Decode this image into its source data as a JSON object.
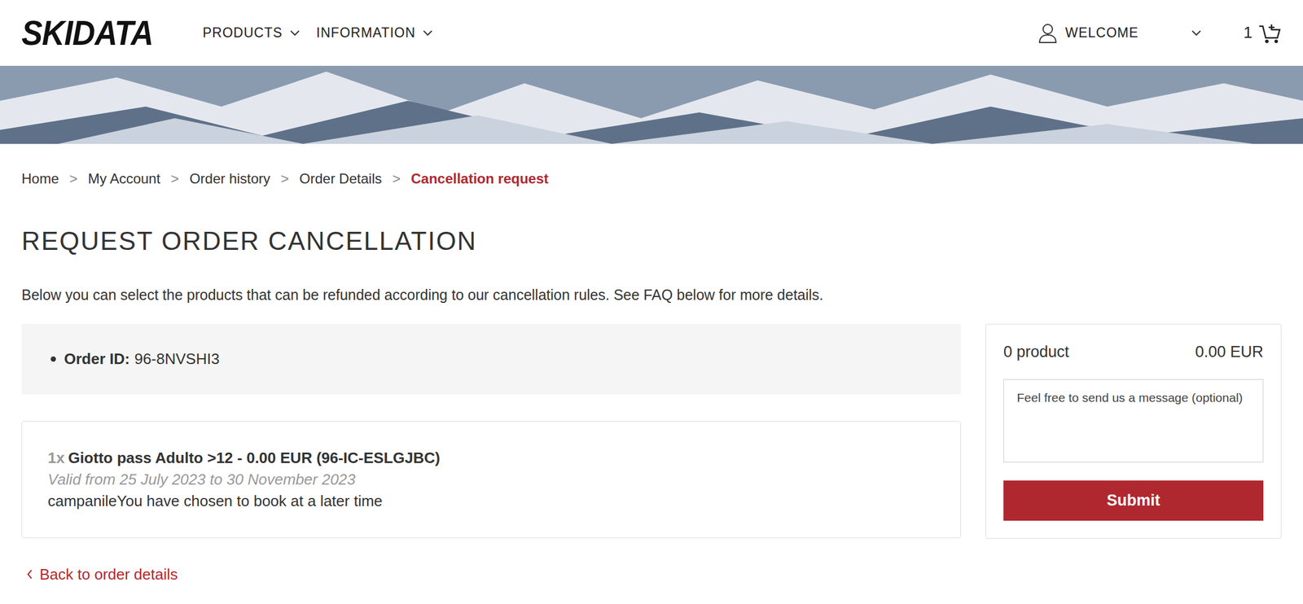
{
  "header": {
    "logo": "SKIDATA",
    "nav": [
      {
        "label": "PRODUCTS"
      },
      {
        "label": "INFORMATION"
      }
    ],
    "account": {
      "label": "WELCOME"
    },
    "cart": {
      "count": "1"
    }
  },
  "breadcrumb": {
    "separator": ">",
    "items": [
      {
        "label": "Home",
        "selected": false
      },
      {
        "label": "My Account",
        "selected": false
      },
      {
        "label": "Order history",
        "selected": false
      },
      {
        "label": "Order Details",
        "selected": false
      },
      {
        "label": "Cancellation request",
        "selected": true
      }
    ]
  },
  "page": {
    "title": "REQUEST ORDER CANCELLATION",
    "intro": "Below you can select the products that can be refunded according to our cancellation rules. See FAQ below for more details."
  },
  "order": {
    "label": "Order ID:",
    "id": "96-8NVSHI3"
  },
  "items": [
    {
      "quantity": "1x",
      "name": "Giotto pass Adulto >12 - 0.00 EUR (96-IC-ESLGJBC)",
      "validity": "Valid from 25 July 2023 to 30 November 2023",
      "note": "campanileYou have chosen to book at a later time"
    }
  ],
  "summary": {
    "count": "0 product",
    "total": "0.00 EUR",
    "message_placeholder": "Feel free to send us a message (optional)",
    "submit": "Submit"
  },
  "back_link": "Back to order details"
}
